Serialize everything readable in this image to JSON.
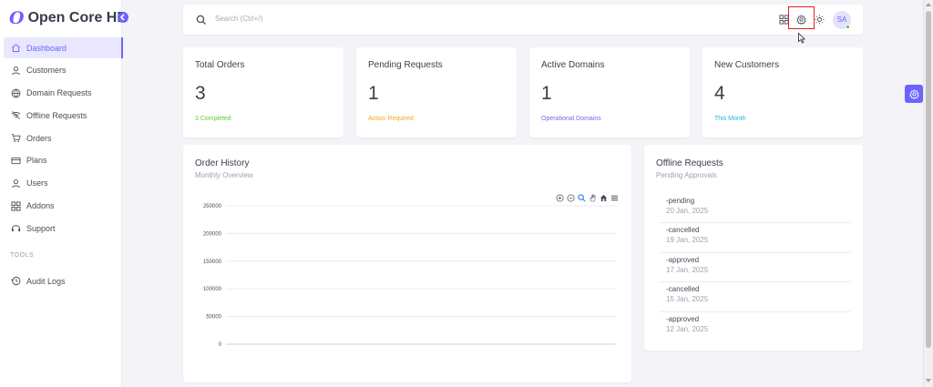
{
  "brand": {
    "logo_glyph": "O",
    "name": "Open Core HR"
  },
  "sidebar": {
    "items": [
      {
        "label": "Dashboard",
        "icon": "home-icon",
        "active": true
      },
      {
        "label": "Customers",
        "icon": "user-icon"
      },
      {
        "label": "Domain Requests",
        "icon": "globe-icon"
      },
      {
        "label": "Offline Requests",
        "icon": "wifi-off-icon"
      },
      {
        "label": "Orders",
        "icon": "cart-icon"
      },
      {
        "label": "Plans",
        "icon": "credit-card-icon"
      },
      {
        "label": "Users",
        "icon": "user-icon"
      },
      {
        "label": "Addons",
        "icon": "apps-icon"
      },
      {
        "label": "Support",
        "icon": "headset-icon"
      }
    ],
    "section_title": "TOOLS",
    "tools": [
      {
        "label": "Audit Logs",
        "icon": "history-icon"
      }
    ]
  },
  "topbar": {
    "search_placeholder": "Search (Ctrl+/)",
    "avatar_initials": "SA"
  },
  "stats": [
    {
      "title": "Total Orders",
      "value": "3",
      "sub": "3 Completed",
      "color": "#5fcf3a"
    },
    {
      "title": "Pending Requests",
      "value": "1",
      "sub": "Action Required",
      "color": "#f5a623"
    },
    {
      "title": "Active Domains",
      "value": "1",
      "sub": "Operational Domains",
      "color": "#7367f0"
    },
    {
      "title": "New Customers",
      "value": "4",
      "sub": "This Month",
      "color": "#1fb6d9"
    }
  ],
  "order_history": {
    "title": "Order History",
    "subtitle": "Monthly Overview"
  },
  "chart_data": {
    "type": "line",
    "y_ticks": [
      "250000",
      "200000",
      "150000",
      "100000",
      "50000",
      "0"
    ],
    "ylim": [
      0,
      250000
    ],
    "series": [],
    "grid": true
  },
  "offline_requests": {
    "title": "Offline Requests",
    "subtitle": "Pending Approvals",
    "items": [
      {
        "status": "-pending",
        "date": "20 Jan, 2025"
      },
      {
        "status": "-cancelled",
        "date": "19 Jan, 2025"
      },
      {
        "status": "-approved",
        "date": "17 Jan, 2025"
      },
      {
        "status": "-cancelled",
        "date": "15 Jan, 2025"
      },
      {
        "status": "-approved",
        "date": "12 Jan, 2025"
      }
    ]
  },
  "colors": {
    "accent": "#6c63ff",
    "highlight": "#e0251b"
  }
}
